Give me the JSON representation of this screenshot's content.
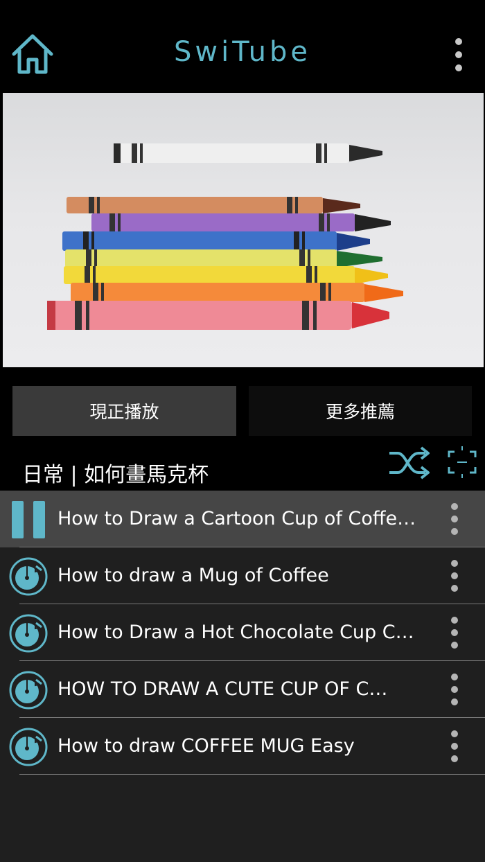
{
  "header": {
    "title": "SwiTube",
    "home_icon": "home-icon",
    "more_icon": "more-vertical-icon"
  },
  "video": {
    "thumbnail": "crayons-thumbnail"
  },
  "tabs": [
    {
      "label": "現正播放",
      "active": true
    },
    {
      "label": "更多推薦",
      "active": false
    }
  ],
  "playlist": {
    "title": "日常 | 如何畫馬克杯",
    "shuffle_icon": "shuffle-icon",
    "fullscreen_icon": "fullscreen-icon"
  },
  "items": [
    {
      "title": "How to Draw a Cartoon Cup of Coffe…",
      "state": "playing",
      "icon": "pause-icon"
    },
    {
      "title": "How to draw a Mug of Coffee",
      "state": "idle",
      "icon": "music-disc-icon"
    },
    {
      "title": "How to Draw a Hot Chocolate Cup C…",
      "state": "idle",
      "icon": "music-disc-icon"
    },
    {
      "title": "HOW TO DRAW A CUTE CUP OF C…",
      "state": "idle",
      "icon": "music-disc-icon"
    },
    {
      "title": "How to draw COFFEE MUG Easy",
      "state": "idle",
      "icon": "music-disc-icon"
    }
  ],
  "colors": {
    "accent": "#5fb7c9",
    "background": "#000000",
    "list_background": "#1f1f1f",
    "playing_row": "#464646",
    "active_tab": "#3a3a3a"
  }
}
